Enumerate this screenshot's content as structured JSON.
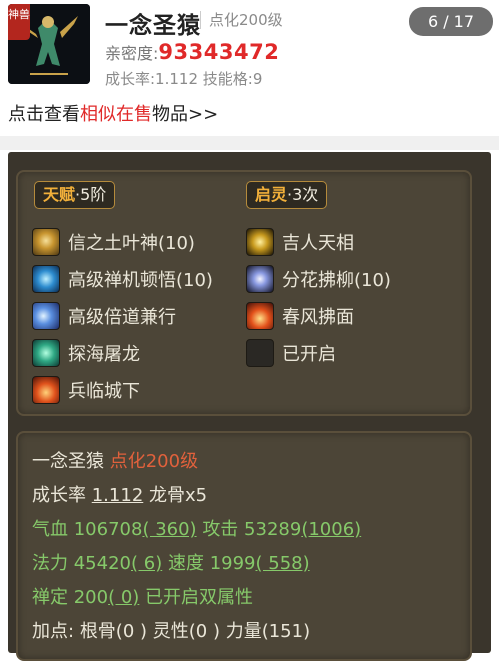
{
  "header": {
    "thumb_badge": "神兽",
    "title": "一念圣猿",
    "title_level": "点化200级",
    "page": "6 / 17",
    "intimacy_label": "亲密度:",
    "intimacy_value": "93343472",
    "growth_line": "成长率:1.112 技能格:9",
    "similar_prefix": "点击查看",
    "similar_link": "相似在售",
    "similar_suffix": "物品>>"
  },
  "talent": {
    "tag_name": "天赋",
    "tag_level": "·5阶",
    "skills": [
      {
        "icon": "scroll-glyph-icon",
        "name": "信之土叶神(10)"
      },
      {
        "icon": "zen-energy-icon",
        "name": "高级禅机顿悟(10)"
      },
      {
        "icon": "wind-swirl-icon",
        "name": "高级倍道兼行"
      },
      {
        "icon": "dragon-icon",
        "name": "探海屠龙"
      },
      {
        "icon": "flame-army-icon",
        "name": "兵临城下"
      }
    ]
  },
  "spirit": {
    "tag_name": "启灵",
    "tag_level": "·3次",
    "skills": [
      {
        "icon": "golden-figure-icon",
        "name": "吉人天相"
      },
      {
        "icon": "flower-burst-icon",
        "name": "分花拂柳(10)"
      },
      {
        "icon": "spring-fire-icon",
        "name": "春风拂面"
      },
      {
        "icon": "empty-slot-icon",
        "name": "已开启"
      }
    ]
  },
  "stats": {
    "name": "一念圣猿",
    "level": "点化200级",
    "growth_label": "成长率",
    "growth_value": "1.112",
    "dragon_bone": "龙骨x5",
    "hp_label": "气血",
    "hp_value": "106708",
    "hp_bonus": "( 360)",
    "atk_label": "攻击",
    "atk_value": "53289",
    "atk_bonus": "(1006)",
    "mp_label": "法力",
    "mp_value": "45420",
    "mp_bonus": "( 6)",
    "spd_label": "速度",
    "spd_value": "1999",
    "spd_bonus": "( 558)",
    "zen_label": "禅定",
    "zen_value": "200",
    "zen_bonus": "( 0)",
    "dual_attr": "已开启双属性",
    "points_label": "加点:",
    "points_line": "根骨(0 ) 灵性(0 ) 力量(151)"
  },
  "colors": {
    "accent_red": "#e02929",
    "panel_bg": "#3a352c",
    "gold": "#f2b03a",
    "green": "#86c96a"
  }
}
